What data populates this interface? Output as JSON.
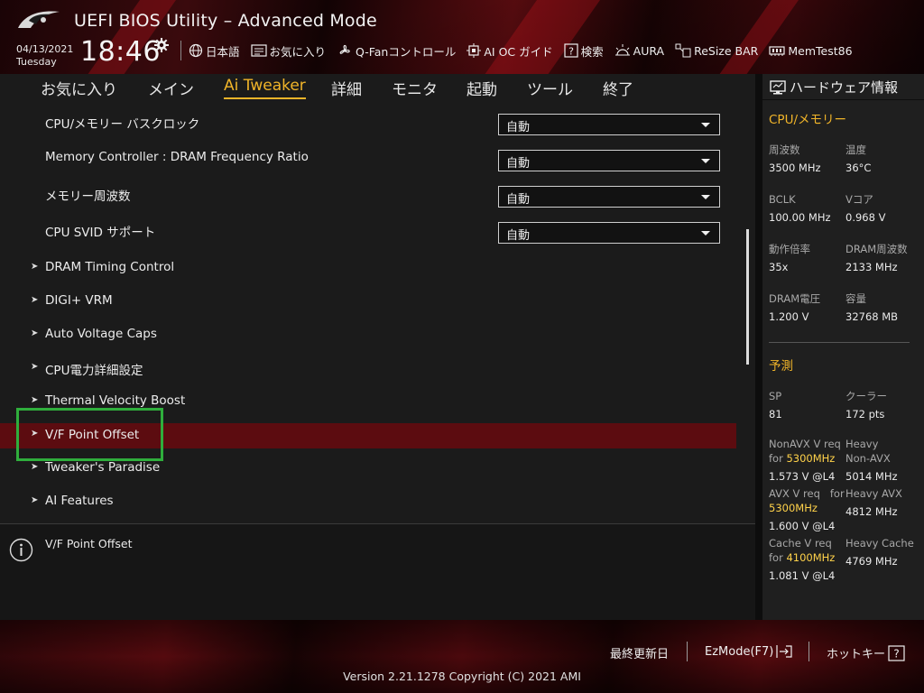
{
  "header": {
    "title": "UEFI BIOS Utility – Advanced Mode",
    "date": "04/13/2021",
    "day": "Tuesday",
    "time": "18:46",
    "toolbar": [
      {
        "label": "日本語",
        "icon": "globe-icon"
      },
      {
        "label": "お気に入り",
        "icon": "favorites-icon"
      },
      {
        "label": "Q-Fanコントロール",
        "icon": "fan-icon"
      },
      {
        "label": "AI OC ガイド",
        "icon": "ai-oc-guide-icon"
      },
      {
        "label": "検索",
        "icon": "search-help-icon"
      },
      {
        "label": "AURA",
        "icon": "aura-icon"
      },
      {
        "label": "ReSize BAR",
        "icon": "resize-bar-icon"
      },
      {
        "label": "MemTest86",
        "icon": "memtest-icon"
      }
    ]
  },
  "menu": {
    "tabs": [
      "お気に入り",
      "メイン",
      "Ai Tweaker",
      "詳細",
      "モニタ",
      "起動",
      "ツール",
      "終了"
    ],
    "active": "Ai Tweaker"
  },
  "settings": [
    {
      "label": "CPU/メモリー バスクロック",
      "value": "自動"
    },
    {
      "label": "Memory Controller : DRAM Frequency Ratio",
      "value": "自動"
    },
    {
      "label": "メモリー周波数",
      "value": "自動"
    },
    {
      "label": "CPU SVID サポート",
      "value": "自動"
    }
  ],
  "submenus": [
    "DRAM Timing Control",
    "DIGI+ VRM",
    "Auto Voltage Caps",
    "CPU電力詳細設定",
    "Thermal Velocity Boost",
    "V/F Point Offset",
    "Tweaker's Paradise",
    "AI Features"
  ],
  "selected_item": "V/F Point Offset",
  "description": "V/F Point Offset",
  "hw": {
    "title": "ハードウェア情報",
    "cpu_section": "CPU/メモリー",
    "cpu": [
      {
        "k": "周波数",
        "v": "3500 MHz"
      },
      {
        "k": "温度",
        "v": "36°C"
      },
      {
        "k": "BCLK",
        "v": "100.00 MHz"
      },
      {
        "k": "Vコア",
        "v": "0.968 V"
      },
      {
        "k": "動作倍率",
        "v": "35x"
      },
      {
        "k": "DRAM周波数",
        "v": "2133 MHz"
      },
      {
        "k": "DRAM電圧",
        "v": "1.200 V"
      },
      {
        "k": "容量",
        "v": "32768 MB"
      }
    ],
    "predict_section": "予測",
    "sp_label": "SP",
    "sp_value": "81",
    "cooler_label": "クーラー",
    "cooler_value": "172 pts",
    "nonavx_req": "NonAVX V req",
    "nonavx_for": "for",
    "nonavx_freq": "5300MHz",
    "nonavx_v": "1.573 V @L4",
    "heavy_label": "Heavy",
    "heavy_nonavx": "Non-AVX",
    "heavy_nonavx_v": "5014 MHz",
    "avx_req": "AVX V req",
    "avx_for": "for",
    "avx_freq": "5300MHz",
    "avx_v": "1.600 V @L4",
    "heavy_avx": "Heavy AVX",
    "heavy_avx_v": "4812 MHz",
    "cache_req": "Cache V req",
    "cache_for": "for",
    "cache_freq": "4100MHz",
    "cache_v": "1.081 V @L4",
    "heavy_cache": "Heavy Cache",
    "heavy_cache_v": "4769 MHz"
  },
  "footer": {
    "last_modified": "最終更新日",
    "ezmode": "EzMode(F7)",
    "hotkeys": "ホットキー",
    "version": "Version 2.21.1278 Copyright (C) 2021 AMI"
  },
  "colors": {
    "accent": "#f0b429",
    "selection": "#5c0c10",
    "focus_box": "#2fae3c"
  }
}
